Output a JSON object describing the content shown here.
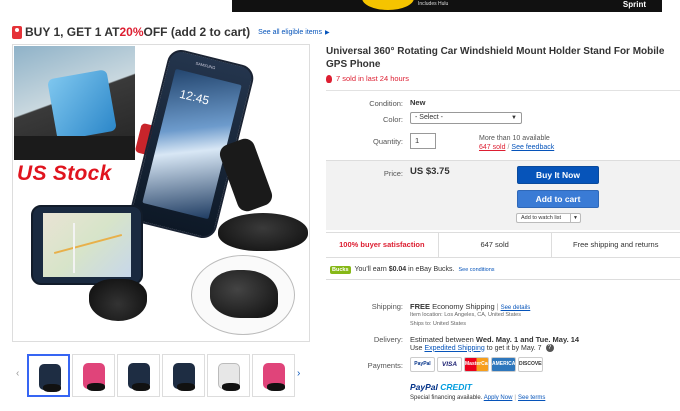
{
  "banner": {
    "tiny_text": "Includes Hulu",
    "brand": "Sprint"
  },
  "promo": {
    "lead": "BUY 1, GET 1 AT ",
    "percent": "20%",
    "rest": " OFF (add 2 to cart)",
    "link": "See all eligible items"
  },
  "image": {
    "overlay_text": "US Stock",
    "phone_clock": "12:45",
    "phone_brand": "SAMSUNG"
  },
  "thumbnails": {
    "count": 6
  },
  "listing": {
    "title": "Universal 360° Rotating Car Windshield Mount Holder Stand For Mobile GPS Phone",
    "sold_recent": "7 sold in last 24 hours"
  },
  "fields": {
    "condition_label": "Condition:",
    "condition_value": "New",
    "color_label": "Color:",
    "color_selected": "- Select -",
    "quantity_label": "Quantity:",
    "quantity_value": "1",
    "availability": "More than 10 available",
    "sold_count": "647 sold",
    "feedback_link": "See feedback"
  },
  "buy": {
    "price_label": "Price:",
    "price_value": "US $3.75",
    "buy_now": "Buy It Now",
    "add_to_cart": "Add to cart",
    "watch": "Add to watch list"
  },
  "stats": {
    "satisfaction": "100% buyer satisfaction",
    "sold": "647 sold",
    "shipping_returns": "Free shipping and returns"
  },
  "bucks": {
    "logo": "Bucks",
    "prefix": "You'll earn ",
    "amount": "$0.04",
    "suffix": " in eBay Bucks.",
    "link": "See conditions"
  },
  "shipping": {
    "label": "Shipping:",
    "free": "FREE",
    "method": " Economy Shipping",
    "details_link": "See details",
    "item_location": "Item location:  Los Angeles, CA, United States",
    "ships_to": "Ships to:  United States"
  },
  "delivery": {
    "label": "Delivery:",
    "estimate_prefix": "Estimated between ",
    "estimate_dates": "Wed. May. 1 and Tue. May. 14",
    "use": "Use",
    "expedited_link": "Expedited Shipping",
    "by_date": "to get it by May. 7",
    "help": "?"
  },
  "payments": {
    "label": "Payments:",
    "icons": [
      "PayPal",
      "VISA",
      "MasterCard",
      "AMERICAN EXPRESS",
      "DISCOVER"
    ],
    "paypal_credit_a": "PayPal ",
    "paypal_credit_b": "CREDIT",
    "special": "Special financing available.",
    "apply_link": "Apply Now",
    "terms_link": "See terms"
  },
  "colors": {
    "ebay_blue": "#0654ba",
    "alert_red": "#dd1e31",
    "bucks_green": "#86b817"
  }
}
